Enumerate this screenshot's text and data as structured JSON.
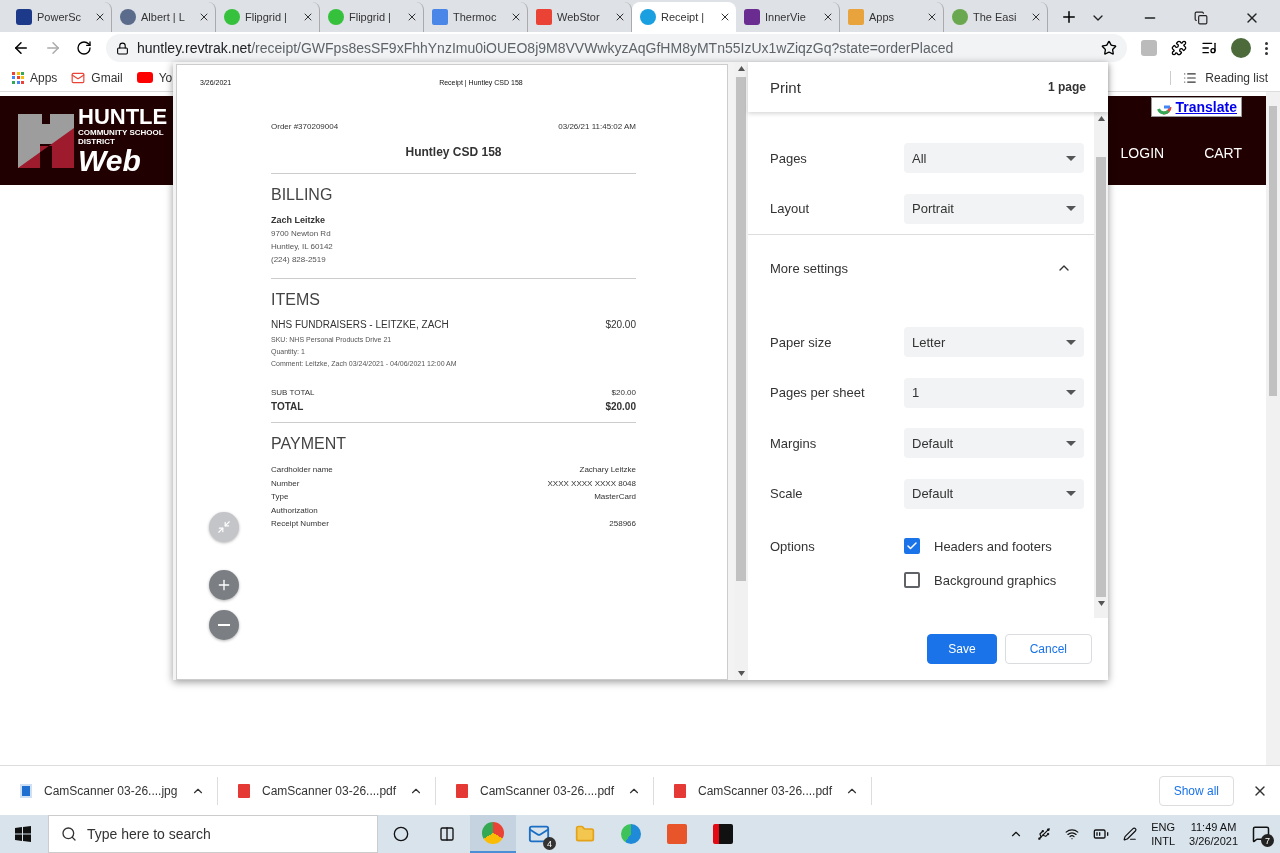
{
  "browser": {
    "tabs": [
      {
        "title": "PowerSc",
        "selected": false
      },
      {
        "title": "Albert | L",
        "selected": false
      },
      {
        "title": "Flipgrid |",
        "selected": false
      },
      {
        "title": "Flipgrid |",
        "selected": false
      },
      {
        "title": "Thermoc",
        "selected": false
      },
      {
        "title": "WebStor",
        "selected": false
      },
      {
        "title": "Receipt |",
        "selected": true
      },
      {
        "title": "InnerVie",
        "selected": false
      },
      {
        "title": "Apps",
        "selected": false
      },
      {
        "title": "The Easi",
        "selected": false
      }
    ],
    "address": {
      "host": "huntley.revtrak.net",
      "path": "/receipt/GWFps8esSF9xFhhYnzImu0iOUEO8j9M8VVWwkyzAqGfHM8yMTn55IzUx1wZiqzGq?state=orderPlaced"
    },
    "bookmarks": [
      "Apps",
      "Gmail",
      "Yo"
    ],
    "reading_list": "Reading list"
  },
  "site": {
    "logo": [
      "HUNTLE",
      "COMMUNITY SCHOOL DISTRICT",
      "Web"
    ],
    "translate": "Translate",
    "nav": [
      "LOGIN",
      "CART"
    ]
  },
  "preview": {
    "header_date": "3/26/2021",
    "header_title": "Receipt | Huntley CSD 158",
    "order": "Order #370209004",
    "datetime": "03/26/21 11:45:02 AM",
    "org": "Huntley CSD 158",
    "billing": {
      "heading": "BILLING",
      "name": "Zach Leitzke",
      "lines": [
        "9700 Newton Rd",
        "Huntley, IL 60142",
        "(224) 828-2519"
      ]
    },
    "items": {
      "heading": "ITEMS",
      "rows": [
        {
          "name": "NHS FUNDRAISERS - LEITZKE, ZACH",
          "price": "$20.00",
          "details": [
            "SKU: NHS Personal Products Drive 21",
            "Quantity: 1",
            "Comment: Leitzke, Zach 03/24/2021 - 04/06/2021 12:00 AM"
          ]
        }
      ]
    },
    "subtotal": {
      "label": "SUB TOTAL",
      "value": "$20.00"
    },
    "total": {
      "label": "TOTAL",
      "value": "$20.00"
    },
    "payment": {
      "heading": "PAYMENT",
      "rows": [
        {
          "label": "Cardholder name",
          "value": "Zachary Leitzke"
        },
        {
          "label": "Number",
          "value": "XXXX XXXX XXXX 8048"
        },
        {
          "label": "Type",
          "value": "MasterCard"
        },
        {
          "label": "Authorization"
        },
        {
          "label": "Receipt Number",
          "value": "258966"
        }
      ]
    }
  },
  "print": {
    "title": "Print",
    "pages": "1 page",
    "settings": [
      {
        "kind": "select",
        "label": "Pages",
        "value": "All"
      },
      {
        "kind": "select",
        "label": "Layout",
        "value": "Portrait"
      },
      {
        "kind": "toggle",
        "label": "More settings",
        "expanded": true
      },
      {
        "kind": "select",
        "label": "Paper size",
        "value": "Letter"
      },
      {
        "kind": "select",
        "label": "Pages per sheet",
        "value": "1"
      },
      {
        "kind": "select",
        "label": "Margins",
        "value": "Default"
      },
      {
        "kind": "select",
        "label": "Scale",
        "value": "Default"
      },
      {
        "kind": "options",
        "label": "Options",
        "checks": [
          {
            "label": "Headers and footers",
            "checked": true
          },
          {
            "label": "Background graphics",
            "checked": false
          }
        ]
      }
    ],
    "buttons": [
      "Save",
      "Cancel"
    ]
  },
  "downloads": {
    "files": [
      {
        "name": "CamScanner 03-26....jpg",
        "kind": "image"
      },
      {
        "name": "CamScanner 03-26....pdf",
        "kind": "pdf"
      },
      {
        "name": "CamScanner 03-26....pdf",
        "kind": "pdf"
      },
      {
        "name": "CamScanner 03-26....pdf",
        "kind": "pdf"
      }
    ],
    "show_all": "Show all"
  },
  "taskbar": {
    "search": {
      "placeholder": "Type here to search"
    },
    "mail_badge": "4",
    "lang": [
      "ENG",
      "INTL"
    ],
    "time": "11:49 AM",
    "date": "3/26/2021",
    "notifications": "7"
  }
}
